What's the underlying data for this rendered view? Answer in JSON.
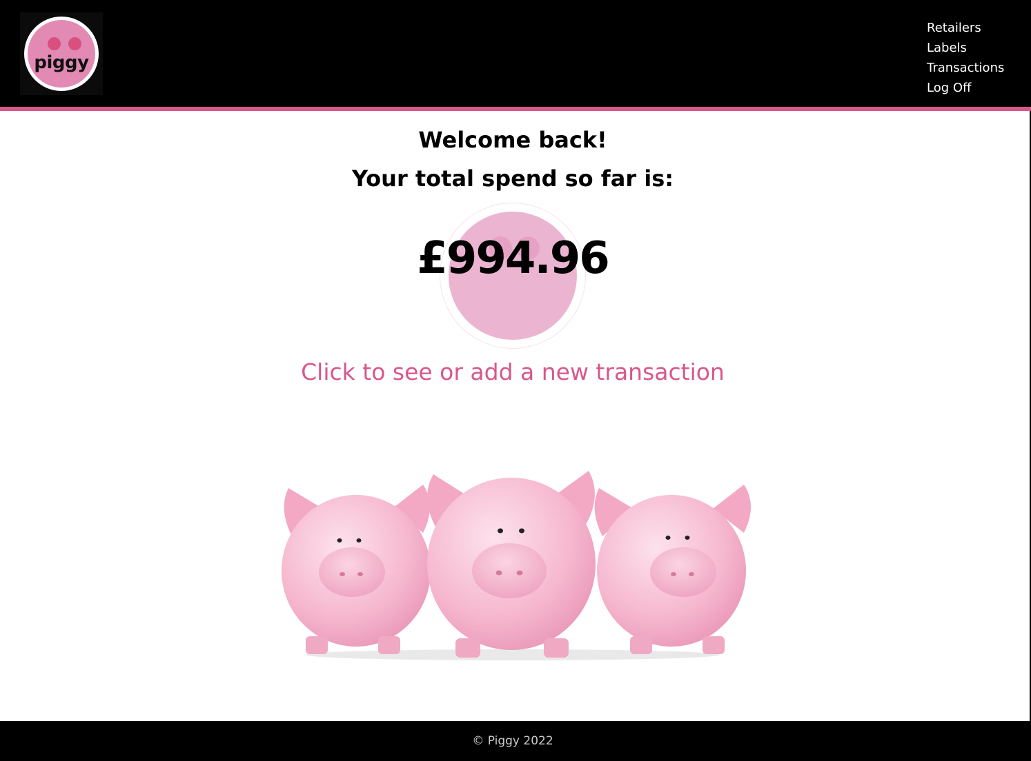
{
  "brand": {
    "logo_text": "piggy",
    "colors": {
      "accent": "#d9568a",
      "logo_pink": "#e28ab4",
      "nostril": "#d94f80",
      "badge_pink": "#ebb5d2",
      "pig_pink": "#f4b6cc",
      "header_bg": "#000000"
    }
  },
  "nav": {
    "items": [
      {
        "label": "Retailers"
      },
      {
        "label": "Labels"
      },
      {
        "label": "Transactions"
      },
      {
        "label": "Log Off"
      }
    ]
  },
  "main": {
    "welcome": "Welcome back!",
    "spend_label": "Your total spend so far is:",
    "total": "£994.96",
    "cta": "Click to see or add a new transaction",
    "hero_icon": "three-piggy-banks"
  },
  "footer": {
    "text": "© Piggy 2022"
  }
}
